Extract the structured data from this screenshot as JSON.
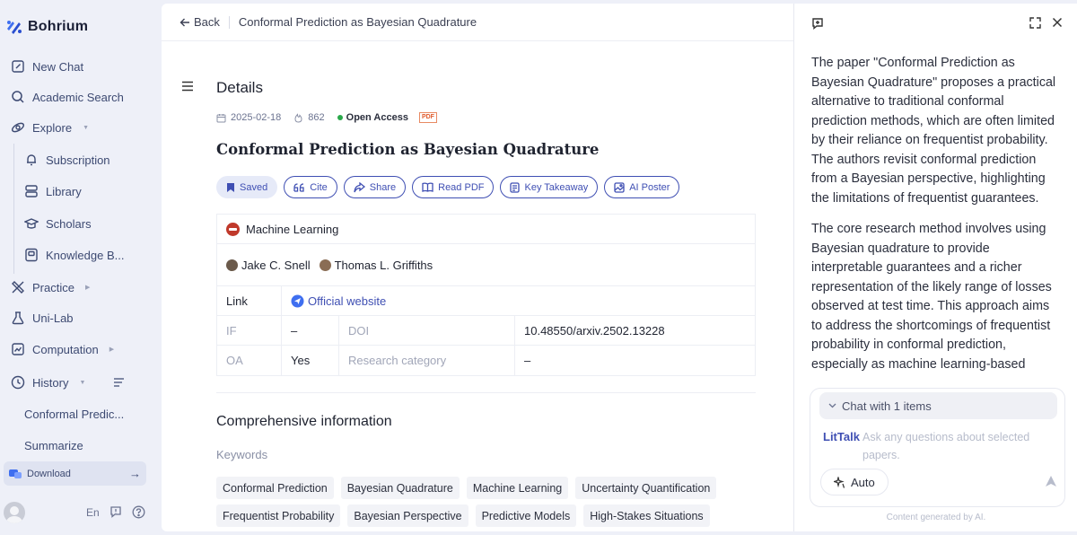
{
  "app": {
    "name": "Bohrium"
  },
  "sidebar": {
    "items": [
      {
        "label": "New Chat",
        "icon": "edit-icon"
      },
      {
        "label": "Academic Search",
        "icon": "search-icon"
      },
      {
        "label": "Explore",
        "icon": "compass-icon"
      },
      {
        "label": "Subscription",
        "icon": "bell-icon"
      },
      {
        "label": "Library",
        "icon": "library-icon"
      },
      {
        "label": "Scholars",
        "icon": "scholar-icon"
      },
      {
        "label": "Knowledge B...",
        "icon": "knowledge-base-icon"
      },
      {
        "label": "Practice",
        "icon": "practice-icon"
      },
      {
        "label": "Uni-Lab",
        "icon": "flask-icon"
      },
      {
        "label": "Computation",
        "icon": "chart-icon"
      },
      {
        "label": "History",
        "icon": "history-icon"
      }
    ],
    "history": [
      "Conformal Predic...",
      "Summarize"
    ],
    "download": "Download",
    "language": "En"
  },
  "topbar": {
    "back": "Back",
    "title": "Conformal Prediction as Bayesian Quadrature"
  },
  "details": {
    "heading": "Details",
    "date": "2025-02-18",
    "views": "862",
    "access": "Open Access",
    "pdf_badge": "PDF",
    "paper_title": "Conformal Prediction as Bayesian Quadrature",
    "actions": [
      "Saved",
      "Cite",
      "Share",
      "Read PDF",
      "Key Takeaway",
      "AI Poster"
    ],
    "category": "Machine Learning",
    "authors": [
      "Jake C. Snell",
      "Thomas L. Griffiths"
    ],
    "link_label": "Link",
    "link_text": "Official website",
    "if_label": "IF",
    "if_value": "–",
    "doi_label": "DOI",
    "doi_value": "10.48550/arxiv.2502.13228",
    "oa_label": "OA",
    "oa_value": "Yes",
    "rc_label": "Research category",
    "rc_value": "–"
  },
  "comprehensive": {
    "heading": "Comprehensive information",
    "keywords_label": "Keywords",
    "keywords_row1": [
      "Conformal Prediction",
      "Bayesian Quadrature",
      "Machine Learning",
      "Uncertainty Quantification"
    ],
    "keywords_row2": [
      "Frequentist Probability",
      "Bayesian Perspective",
      "Predictive Models",
      "High-Stakes Situations"
    ]
  },
  "assistant": {
    "paragraphs": [
      "The paper \"Conformal Prediction as Bayesian Quadrature\" proposes a practical alternative to traditional conformal prediction methods, which are often limited by their reliance on frequentist probability. The authors revisit conformal prediction from a Bayesian perspective, highlighting the limitations of frequentist guarantees.",
      "The core research method involves using Bayesian quadrature to provide interpretable guarantees and a richer representation of the likely range of losses observed at test time. This approach aims to address the shortcomings of frequentist probability in conformal prediction, especially as machine learning-based"
    ],
    "chat_header": "Chat with 1 items",
    "littalk": "LitTalk",
    "placeholder": "Ask any questions about selected papers.",
    "auto": "Auto",
    "footnote": "Content generated by AI."
  },
  "colors": {
    "accent": "#3f4fb3",
    "open_access": "#2aa84a",
    "pdf": "#e05a2b",
    "category": "#c0392b"
  }
}
